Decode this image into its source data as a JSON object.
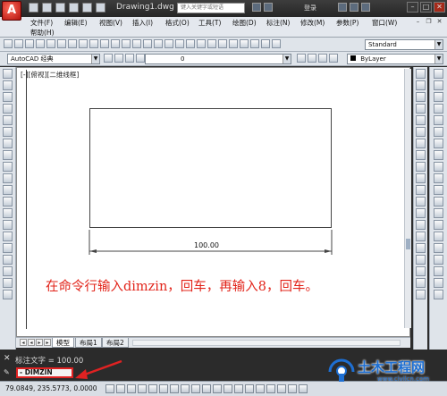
{
  "titlebar": {
    "app_letter": "A",
    "doc_title": "Drawing1.dwg",
    "search_placeholder": "键入关键字或短语",
    "login": "登录"
  },
  "menubar": {
    "items": [
      "文件(F)",
      "编辑(E)",
      "视图(V)",
      "插入(I)",
      "格式(O)",
      "工具(T)",
      "绘图(D)",
      "标注(N)",
      "修改(M)",
      "参数(P)",
      "窗口(W)"
    ],
    "help": "帮助(H)"
  },
  "toolbar": {
    "text_style": "Standard",
    "workspace": "AutoCAD 经典",
    "layer": "0",
    "color": "ByLayer"
  },
  "viewport": {
    "label": "[-][俯视][二维线框]"
  },
  "drawing": {
    "dimension_text": "100.00",
    "annotation": "在命令行输入dimzin，回车，再输入8，回车。"
  },
  "tabs": [
    "模型",
    "布局1",
    "布局2"
  ],
  "command": {
    "history": "标注文字 = 100.00",
    "prompt": "- DIMZIN"
  },
  "status": {
    "coords": "79.0849, 235.5773, 0.0000"
  },
  "watermark": {
    "title": "土木工程网",
    "url": "www.civilcn.com"
  },
  "colors": {
    "annotation_red": "#e2241a",
    "watermark_blue": "#1e6fd2"
  }
}
